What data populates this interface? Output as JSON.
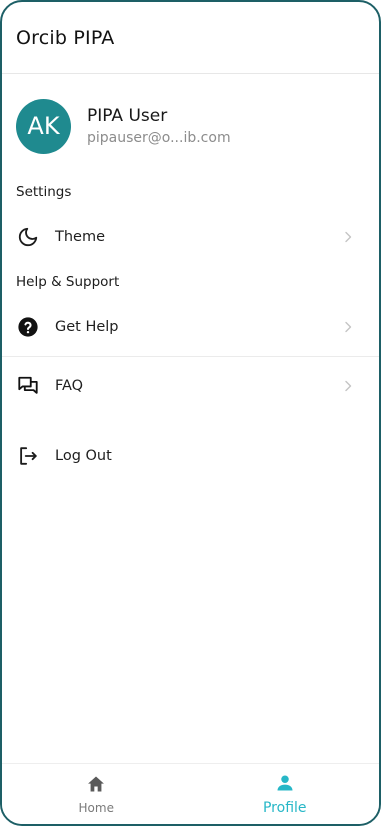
{
  "app": {
    "title": "Orcib PIPA"
  },
  "profile": {
    "initials": "AK",
    "name": "PIPA User",
    "email": "pipauser@o...ib.com"
  },
  "sections": {
    "settings": {
      "label": "Settings",
      "theme_label": "Theme"
    },
    "help": {
      "label": "Help & Support",
      "get_help_label": "Get Help",
      "faq_label": "FAQ"
    }
  },
  "logout": {
    "label": "Log Out"
  },
  "nav": {
    "home_label": "Home",
    "profile_label": "Profile"
  },
  "colors": {
    "accent": "#27b7c7",
    "avatar_bg": "#1f8a8f",
    "frame": "#1d5f66"
  },
  "icons": {
    "theme": "moon-icon",
    "get_help": "help-circle-icon",
    "faq": "chat-bubbles-icon",
    "logout": "logout-icon",
    "home": "home-icon",
    "profile": "person-icon"
  }
}
